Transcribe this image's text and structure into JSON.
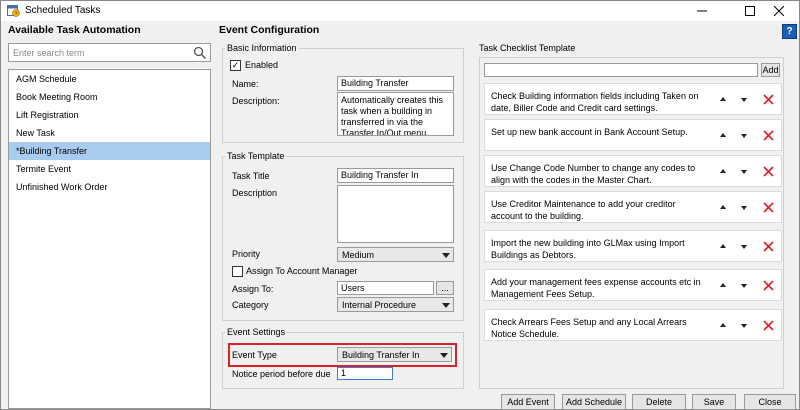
{
  "window": {
    "title": "Scheduled Tasks"
  },
  "left": {
    "heading": "Available Task Automation",
    "search_placeholder": "Enter search term",
    "tasks": [
      "AGM Schedule",
      "Book Meeting Room",
      "Lift Registration",
      "New Task",
      "*Building Transfer",
      "Termite Event",
      "Unfinished Work Order"
    ],
    "selected_index": 4
  },
  "config": {
    "heading": "Event Configuration",
    "basic": {
      "legend": "Basic Information",
      "enabled_label": "Enabled",
      "enabled_checked": true,
      "name_label": "Name:",
      "name_value": "Building Transfer",
      "description_label": "Description:",
      "description_value": "Automatically creates this task when a building in transferred in via the Transfer In/Out menu."
    },
    "template": {
      "legend": "Task Template",
      "title_label": "Task Title",
      "title_value": "Building Transfer In",
      "description_label": "Description",
      "description_value": "",
      "priority_label": "Priority",
      "priority_value": "Medium",
      "assign_manager_label": "Assign To Account Manager",
      "assign_manager_checked": false,
      "assign_to_label": "Assign To:",
      "assign_to_value": "Users",
      "browse_label": "...",
      "category_label": "Category",
      "category_value": "Internal Procedure"
    },
    "event": {
      "legend": "Event Settings",
      "event_type_label": "Event Type",
      "event_type_value": "Building Transfer In",
      "notice_label": "Notice period before due",
      "notice_value": "1"
    }
  },
  "checklist": {
    "legend": "Task Checklist Template",
    "new_item_value": "",
    "add_label": "Add",
    "items": [
      "Check Building information fields including Taken on date, Biller Code and Credit card settings.",
      "Set up new bank account in Bank Account Setup.",
      "Use Change Code Number to change any codes to align with the codes in the Master Chart.",
      "Use Creditor Maintenance to add your creditor account to the building.",
      "Import the new building into GLMax using Import Buildings as Debtors.",
      "Add your management fees expense accounts etc in Management Fees Setup.",
      "Check Arrears Fees Setup and any Local Arrears Notice Schedule."
    ]
  },
  "footer": {
    "add_event": "Add Event",
    "add_schedule": "Add Schedule",
    "delete": "Delete",
    "save": "Save",
    "close": "Close"
  },
  "icons": {
    "app": "calendar-clock-icon",
    "search": "search-icon",
    "help": "help-icon",
    "move_up": "arrow-up-icon",
    "move_down": "arrow-down-icon",
    "delete": "delete-x-icon"
  },
  "colors": {
    "selection": "#a8cbf0",
    "delete_x": "#d9212a",
    "highlight_border": "#d9212a",
    "help_blue": "#1c5fb6"
  }
}
